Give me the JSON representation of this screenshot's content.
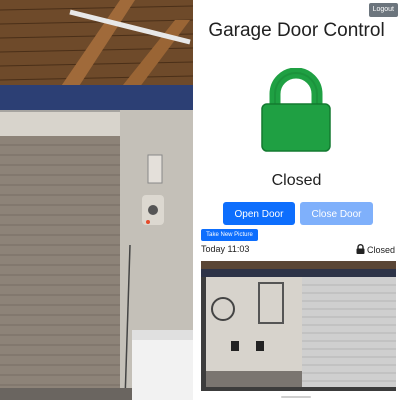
{
  "header": {
    "title": "Garage Door Control",
    "logout_label": "Logout"
  },
  "door": {
    "status": "Closed"
  },
  "actions": {
    "open_label": "Open Door",
    "close_label": "Close Door",
    "picture_label": "Take New Picture"
  },
  "snapshot": {
    "timestamp": "Today 11:03",
    "status": "Closed"
  },
  "colors": {
    "lock_green": "#1fa043",
    "primary": "#0d6efd",
    "primary_disabled": "#7fb0fb"
  },
  "icons": {
    "big": "lock-closed-icon",
    "small": "lock-small-icon"
  }
}
